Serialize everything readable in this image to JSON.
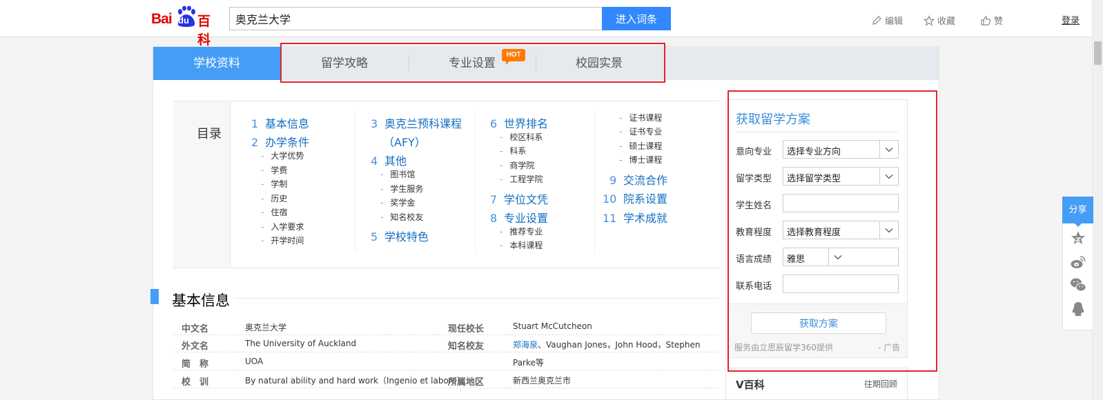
{
  "header": {
    "logo_bai": "Bai",
    "logo_du": "du",
    "logo_baike": "百科",
    "search_value": "奥克兰大学",
    "search_button": "进入词条",
    "edit": "编辑",
    "favorite": "收藏",
    "like": "赞",
    "login": "登录"
  },
  "tabs": [
    {
      "label": "学校资料",
      "active": true
    },
    {
      "label": "留学攻略",
      "active": false
    },
    {
      "label": "专业设置",
      "active": false,
      "badge": "HOT"
    },
    {
      "label": "校园实景",
      "active": false
    }
  ],
  "catalog": {
    "title": "目录",
    "col1": {
      "items": [
        {
          "num": "1",
          "label": "基本信息"
        },
        {
          "num": "2",
          "label": "办学条件"
        }
      ],
      "subs": [
        "大学优势",
        "学费",
        "学制",
        "历史",
        "住宿",
        "入学要求",
        "开学时间"
      ]
    },
    "col2": {
      "item3_num": "3",
      "item3_label": "奥克兰预科课程",
      "item3_cont": "（AFY）",
      "item4_num": "4",
      "item4_label": "其他",
      "subs": [
        "图书馆",
        "学生服务",
        "奖学金",
        "知名校友"
      ],
      "item5_num": "5",
      "item5_label": "学校特色"
    },
    "col3": {
      "item6_num": "6",
      "item6_label": "世界排名",
      "subs6": [
        "校区科系",
        "科系",
        "商学院",
        "工程学院"
      ],
      "item7_num": "7",
      "item7_label": "学位文凭",
      "item8_num": "8",
      "item8_label": "专业设置",
      "subs8": [
        "推荐专业",
        "本科课程"
      ]
    },
    "col4": {
      "subs": [
        "证书课程",
        "证书专业",
        "硕士课程",
        "博士课程"
      ],
      "item9_num": "9",
      "item9_label": "交流合作",
      "item10_num": "10",
      "item10_label": "院系设置",
      "item11_num": "11",
      "item11_label": "学术成就"
    }
  },
  "section": {
    "title": "基本信息"
  },
  "info": {
    "r1": {
      "k1": "中文名",
      "v1": "奥克兰大学",
      "k2": "现任校长",
      "v2": "Stuart McCutcheon"
    },
    "r2": {
      "k1": "外文名",
      "v1": "The University of Auckland",
      "k2": "知名校友",
      "v2_link": "郑海泉",
      "v2_rest": "、Vaughan Jones，John Hood，Stephen"
    },
    "r3": {
      "k1": "简　称",
      "v1": "UOA",
      "k2": "",
      "v2": "Parke等"
    },
    "r4": {
      "k1": "校　训",
      "v1": "By natural ability and hard work（Ingenio et labore）",
      "k2": "所属地区",
      "v2": "新西兰奥克兰市"
    }
  },
  "form": {
    "title": "获取留学方案",
    "major_label": "意向专业",
    "major_value": "选择专业方向",
    "type_label": "留学类型",
    "type_value": "选择留学类型",
    "name_label": "学生姓名",
    "edu_label": "教育程度",
    "edu_value": "选择教育程度",
    "lang_label": "语言成绩",
    "lang_value": "雅思",
    "phone_label": "联系电话",
    "submit": "获取方案",
    "provider": "服务由立思辰留学360提供",
    "ad": "- 广告"
  },
  "vbaike": {
    "title": "V百科",
    "more": "往期回顾"
  },
  "share": {
    "label": "分享"
  },
  "colors": {
    "accent": "#459df5",
    "link": "#136ec2",
    "hot": "#ff7b00",
    "logo_red": "#e10601",
    "logo_blue": "#2932e1",
    "highlight": "#e5222c"
  }
}
